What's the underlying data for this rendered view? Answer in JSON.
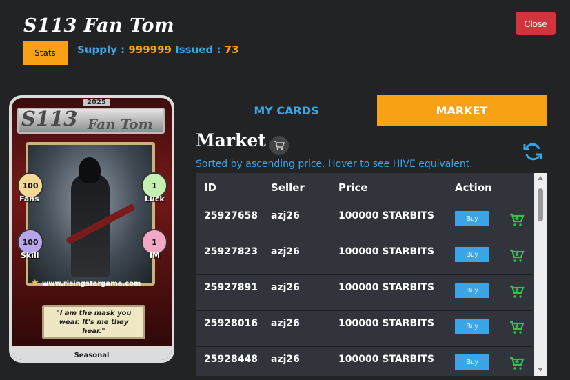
{
  "header": {
    "title": "S113 Fan Tom",
    "close_label": "Close",
    "stats_label": "Stats",
    "supply_label": "Supply : ",
    "supply_value": "999999",
    "issued_label": " Issued : ",
    "issued_value": "73"
  },
  "card": {
    "year": "2025",
    "series": "S113",
    "name": "Fan Tom",
    "stats": {
      "fans": {
        "value": "100",
        "label": "Fans",
        "color": "#f5d995"
      },
      "luck": {
        "value": "1",
        "label": "Luck",
        "color": "#c6f0b2"
      },
      "skill": {
        "value": "100",
        "label": "Skill",
        "color": "#b7a6ec"
      },
      "im": {
        "value": "1",
        "label": "IM",
        "color": "#f4a7c4"
      }
    },
    "url": "www.risingstargame.com",
    "quote": "\"I am the mask you wear. It's me they hear.\"",
    "rarity": "Seasonal"
  },
  "tabs": [
    {
      "label": "MY CARDS",
      "active": false
    },
    {
      "label": "MARKET",
      "active": true
    }
  ],
  "market": {
    "title": "Market",
    "cart_icon": "cart-icon",
    "refresh_icon": "refresh-icon",
    "sorted_text": "Sorted by ascending price. Hover to see HIVE equivalent.",
    "columns": [
      "ID",
      "Seller",
      "Price",
      "Action"
    ],
    "rows": [
      {
        "id": "25927658",
        "seller": "azj26",
        "price": "100000 STARBITS",
        "buy": "Buy"
      },
      {
        "id": "25927823",
        "seller": "azj26",
        "price": "100000 STARBITS",
        "buy": "Buy"
      },
      {
        "id": "25927891",
        "seller": "azj26",
        "price": "100000 STARBITS",
        "buy": "Buy"
      },
      {
        "id": "25928016",
        "seller": "azj26",
        "price": "100000 STARBITS",
        "buy": "Buy"
      },
      {
        "id": "25928448",
        "seller": "azj26",
        "price": "100000 STARBITS",
        "buy": "Buy"
      }
    ]
  },
  "colors": {
    "accent_orange": "#f8a114",
    "accent_blue": "#3aa6e8",
    "close_red": "#d2343b",
    "cart_green": "#33c24a"
  }
}
